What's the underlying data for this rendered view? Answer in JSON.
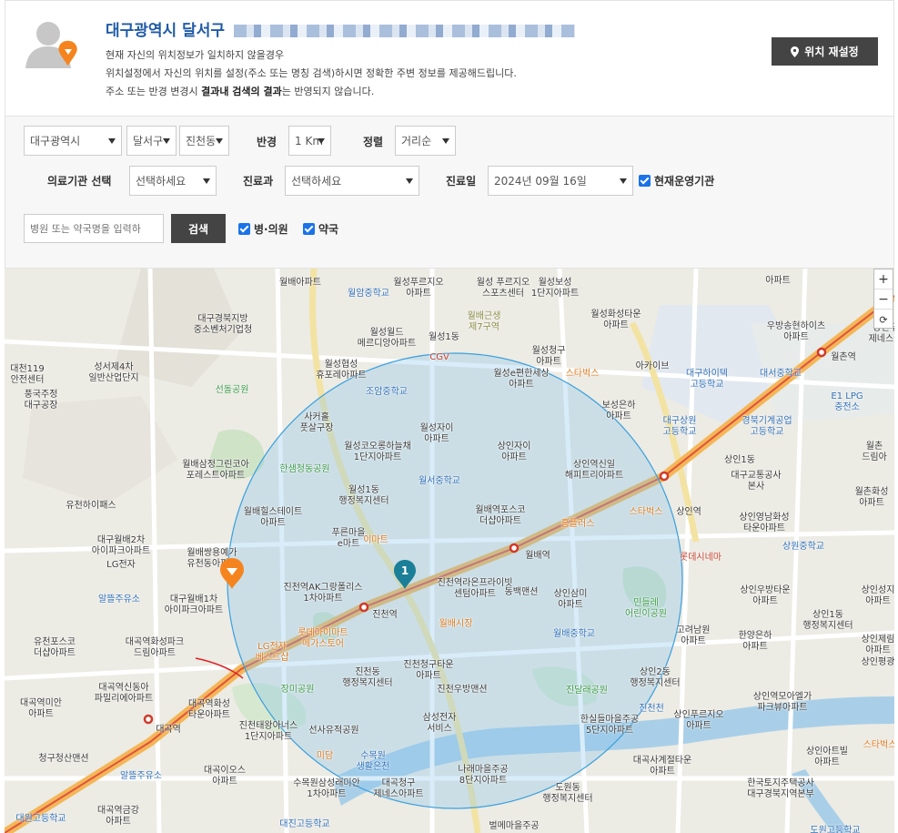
{
  "location": {
    "title": "대구광역시 달서구",
    "line1": "현재 자신의 위치정보가 일치하지 않을경우",
    "line2": "위치설정에서 자신의 위치를 설정(주소 또는 명칭 검색)하시면 정확한 주변 정보를 제공해드립니다.",
    "line3_pre": "주소 또는 반경 변경시 ",
    "line3_bold": "결과내 검색의 결과",
    "line3_post": "는 반영되지 않습니다.",
    "reset_label": "위치 재설정",
    "reset_icon": "location-pin-icon"
  },
  "search": {
    "city": "대구광역시",
    "district": "달서구",
    "dong": "진천동",
    "radius_label": "반경",
    "radius": "1 Km",
    "sort_label": "정렬",
    "sort": "거리순",
    "institution_label": "의료기관 선택",
    "institution": "선택하세요",
    "department_label": "진료과",
    "department": "선택하세요",
    "date_label": "진료일",
    "date": "2024년 09월 16일",
    "open_now_label": "현재운영기관",
    "input_placeholder": "병원 또는 약국명을 입력하",
    "search_button": "검색",
    "hospital_check": "병·의원",
    "pharmacy_check": "약국"
  },
  "map": {
    "zoom_in": "+",
    "zoom_out": "−",
    "refresh": "⟳",
    "marker_number": "1",
    "labels": [
      {
        "t": "월배아파트",
        "c": ""
      },
      {
        "t": "월성푸르지오\n아파트",
        "c": ""
      },
      {
        "t": "월성 푸르지오\n스포츠센터",
        "c": ""
      },
      {
        "t": "월성보성\n1단지아파트",
        "c": ""
      },
      {
        "t": "아파트",
        "c": ""
      },
      {
        "t": "대구경북지방\n중소벤처기업청",
        "c": ""
      },
      {
        "t": "월암중학교",
        "c": "blue"
      },
      {
        "t": "월배근생\n제7구역",
        "c": "olive"
      },
      {
        "t": "월성화성타운\n아파트",
        "c": ""
      },
      {
        "t": "우방송현하이츠\n아파트",
        "c": ""
      },
      {
        "t": "상인푸\n제네스아",
        "c": ""
      },
      {
        "t": "월성월드\n메르디앙아파트",
        "c": ""
      },
      {
        "t": "월성1동",
        "c": ""
      },
      {
        "t": "CGV",
        "c": "red"
      },
      {
        "t": "월성청구\n아파트",
        "c": ""
      },
      {
        "t": "대천119\n안전센터",
        "c": ""
      },
      {
        "t": "성서제4차\n일반산업단지",
        "c": ""
      },
      {
        "t": "월성협성\n휴포레아파트",
        "c": ""
      },
      {
        "t": "월성e편한세상\n아파트",
        "c": ""
      },
      {
        "t": "스타벅스",
        "c": "orange"
      },
      {
        "t": "아카이브",
        "c": ""
      },
      {
        "t": "대구하이텍\n고등학교",
        "c": "blue"
      },
      {
        "t": "대서중학교",
        "c": "blue"
      },
      {
        "t": "월촌역",
        "c": ""
      },
      {
        "t": "풍국주정\n대구공장",
        "c": ""
      },
      {
        "t": "선돌공원",
        "c": "green"
      },
      {
        "t": "조암중학교",
        "c": "blue"
      },
      {
        "t": "보성은하\n아파트",
        "c": ""
      },
      {
        "t": "E1 LPG\n충전소",
        "c": "blue"
      },
      {
        "t": "사커홀\n풋살구장",
        "c": ""
      },
      {
        "t": "월성자이\n아파트",
        "c": ""
      },
      {
        "t": "대구상원\n고등학교",
        "c": "blue"
      },
      {
        "t": "경북기계공업\n고등학교",
        "c": "blue"
      },
      {
        "t": "월성코오롱하늘채\n1단지아파트",
        "c": ""
      },
      {
        "t": "상인자이\n아파트",
        "c": ""
      },
      {
        "t": "월촌\n드림아",
        "c": ""
      },
      {
        "t": "월배삼정그린코아\n포레스트아파트",
        "c": ""
      },
      {
        "t": "한샘청동공원",
        "c": "green"
      },
      {
        "t": "상인역신일\n해피트리아파트",
        "c": ""
      },
      {
        "t": "상인1동",
        "c": ""
      },
      {
        "t": "대구교통공사\n본사",
        "c": ""
      },
      {
        "t": "월성1동\n행정복지센터",
        "c": ""
      },
      {
        "t": "월서중학교",
        "c": "blue"
      },
      {
        "t": "월촌화성\n아파트",
        "c": ""
      },
      {
        "t": "유천하이패스",
        "c": ""
      },
      {
        "t": "월배힐스테이트\n아파트",
        "c": ""
      },
      {
        "t": "월배역포스코\n더샵아파트",
        "c": ""
      },
      {
        "t": "상인역",
        "c": ""
      },
      {
        "t": "스타벅스",
        "c": "orange"
      },
      {
        "t": "상인영남화성\n타운아파트",
        "c": ""
      },
      {
        "t": "대구월배2차\n아이파크아파트",
        "c": ""
      },
      {
        "t": "푸른마을\ne마트",
        "c": ""
      },
      {
        "t": "홈플러스",
        "c": "orange"
      },
      {
        "t": "월배쌍용예가\n유천동아파트",
        "c": ""
      },
      {
        "t": "이마트",
        "c": "orange"
      },
      {
        "t": "상원중학교",
        "c": "blue"
      },
      {
        "t": "LG전자",
        "c": ""
      },
      {
        "t": "월배역",
        "c": ""
      },
      {
        "t": "롯데시네마",
        "c": "red"
      },
      {
        "t": "대구월배1차\n아이파크아파트",
        "c": ""
      },
      {
        "t": "진천역AK그랑폴리스\n1차아파트",
        "c": ""
      },
      {
        "t": "진천역라온프라이빗\n센텀아파트",
        "c": ""
      },
      {
        "t": "동백맨션",
        "c": ""
      },
      {
        "t": "상인삼미\n아파트",
        "c": ""
      },
      {
        "t": "민들레\n어린이공원",
        "c": "green"
      },
      {
        "t": "상인우방타운\n아파트",
        "c": ""
      },
      {
        "t": "상인성지\n아파트",
        "c": ""
      },
      {
        "t": "알뜰주유소",
        "c": "blue"
      },
      {
        "t": "진천역",
        "c": ""
      },
      {
        "t": "월배시장",
        "c": "orange"
      },
      {
        "t": "상인1동\n행정복지센터",
        "c": ""
      },
      {
        "t": "유천포스코\n더샵아파트",
        "c": ""
      },
      {
        "t": "대곡역화성파크\n드림아파트",
        "c": ""
      },
      {
        "t": "롯데아이마트\n메가스토어",
        "c": "orange"
      },
      {
        "t": "월배중학교",
        "c": "blue"
      },
      {
        "t": "고려남원\n아파트",
        "c": ""
      },
      {
        "t": "한양은하\n아파트",
        "c": ""
      },
      {
        "t": "상인제림\n아파트",
        "c": ""
      },
      {
        "t": "LG전자\n베스트샵",
        "c": "orange"
      },
      {
        "t": "진천동\n행정복지센터",
        "c": ""
      },
      {
        "t": "진천청구타운\n아파트",
        "c": ""
      },
      {
        "t": "상인2동\n행정복지센터",
        "c": ""
      },
      {
        "t": "상인평광",
        "c": ""
      },
      {
        "t": "대곡역신동아\n파밀리에아파트",
        "c": ""
      },
      {
        "t": "장미공원",
        "c": "green"
      },
      {
        "t": "진천우방맨션",
        "c": ""
      },
      {
        "t": "진달래공원",
        "c": "green"
      },
      {
        "t": "상인역모아엘가\n파크뷰아파트",
        "c": ""
      },
      {
        "t": "대곡역미안\n아파트",
        "c": ""
      },
      {
        "t": "대곡역화성\n타운아파트",
        "c": ""
      },
      {
        "t": "삼성전자\n서비스",
        "c": ""
      },
      {
        "t": "한실들마을주공\n5단지아파트",
        "c": ""
      },
      {
        "t": "상인푸르지오\n아파트",
        "c": ""
      },
      {
        "t": "대곡역",
        "c": ""
      },
      {
        "t": "진천태왕아너스\n1단지아파트",
        "c": ""
      },
      {
        "t": "선사유적공원",
        "c": ""
      },
      {
        "t": "진천천",
        "c": "blue"
      },
      {
        "t": "청구청산맨션",
        "c": ""
      },
      {
        "t": "미담",
        "c": "orange"
      },
      {
        "t": "수목원\n생활은천",
        "c": "blue"
      },
      {
        "t": "나래마을주공\n8단지아파트",
        "c": ""
      },
      {
        "t": "대곡사계절타운\n아파트",
        "c": ""
      },
      {
        "t": "상인아트빌\n아파트",
        "c": ""
      },
      {
        "t": "스타벅스",
        "c": "orange"
      },
      {
        "t": "대곡이오스\n아파트",
        "c": ""
      },
      {
        "t": "알뜰주유소",
        "c": "blue"
      },
      {
        "t": "수목원삼성래미안\n1차아파트",
        "c": ""
      },
      {
        "t": "대곡청구\n제네스아파트",
        "c": ""
      },
      {
        "t": "도원동\n행정복지센터",
        "c": ""
      },
      {
        "t": "한국토지주택공사\n대구경북지역본부",
        "c": ""
      },
      {
        "t": "대원고등학교",
        "c": "blue"
      },
      {
        "t": "대곡역금강\n아파트",
        "c": ""
      },
      {
        "t": "대진고등학교",
        "c": "blue"
      },
      {
        "t": "벌메마을주공",
        "c": ""
      },
      {
        "t": "도원고등학교",
        "c": "blue"
      }
    ]
  }
}
